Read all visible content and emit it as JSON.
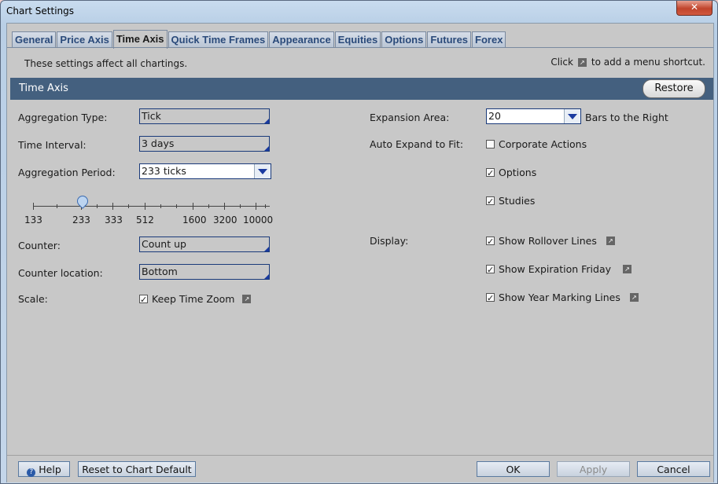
{
  "window": {
    "title": "Chart Settings",
    "close_label": "✕"
  },
  "tabs": [
    {
      "label": "General"
    },
    {
      "label": "Price Axis"
    },
    {
      "label": "Time Axis"
    },
    {
      "label": "Quick Time Frames"
    },
    {
      "label": "Appearance"
    },
    {
      "label": "Equities"
    },
    {
      "label": "Options"
    },
    {
      "label": "Futures"
    },
    {
      "label": "Forex"
    }
  ],
  "header": {
    "note": "These settings affect all chartings.",
    "click_prefix": "Click",
    "click_suffix": "to add a menu shortcut."
  },
  "section": {
    "title": "Time Axis",
    "restore_label": "Restore"
  },
  "left": {
    "aggregation_type": {
      "label": "Aggregation Type:",
      "value": "Tick"
    },
    "time_interval": {
      "label": "Time Interval:",
      "value": "3 days"
    },
    "aggregation_period": {
      "label": "Aggregation Period:",
      "value": "233 ticks"
    },
    "slider": {
      "ticks": [
        "133",
        "233",
        "333",
        "512",
        "1600",
        "3200",
        "10000"
      ],
      "selected": "233"
    },
    "counter": {
      "label": "Counter:",
      "value": "Count up"
    },
    "counter_location": {
      "label": "Counter location:",
      "value": "Bottom"
    },
    "scale": {
      "label": "Scale:",
      "keep_time_zoom": "Keep Time Zoom",
      "checked": true
    }
  },
  "right": {
    "expansion_area": {
      "label": "Expansion Area:",
      "value": "20",
      "suffix": "Bars to the Right"
    },
    "auto_expand": {
      "label": "Auto Expand to Fit:"
    },
    "corporate_actions": {
      "label": "Corporate Actions",
      "checked": false
    },
    "options": {
      "label": "Options",
      "checked": true
    },
    "studies": {
      "label": "Studies",
      "checked": true
    },
    "display": {
      "label": "Display:"
    },
    "rollover": {
      "label": "Show Rollover Lines",
      "checked": true
    },
    "expiration": {
      "label": "Show Expiration Friday",
      "checked": true
    },
    "year_marking": {
      "label": "Show Year Marking Lines",
      "checked": true
    }
  },
  "footer": {
    "help": "Help",
    "reset": "Reset to Chart Default",
    "ok": "OK",
    "apply": "Apply",
    "cancel": "Cancel"
  },
  "colors": {
    "section_bg": "#44607f",
    "field_border": "#1a3a7a",
    "tab_text": "#2a4a7a"
  }
}
